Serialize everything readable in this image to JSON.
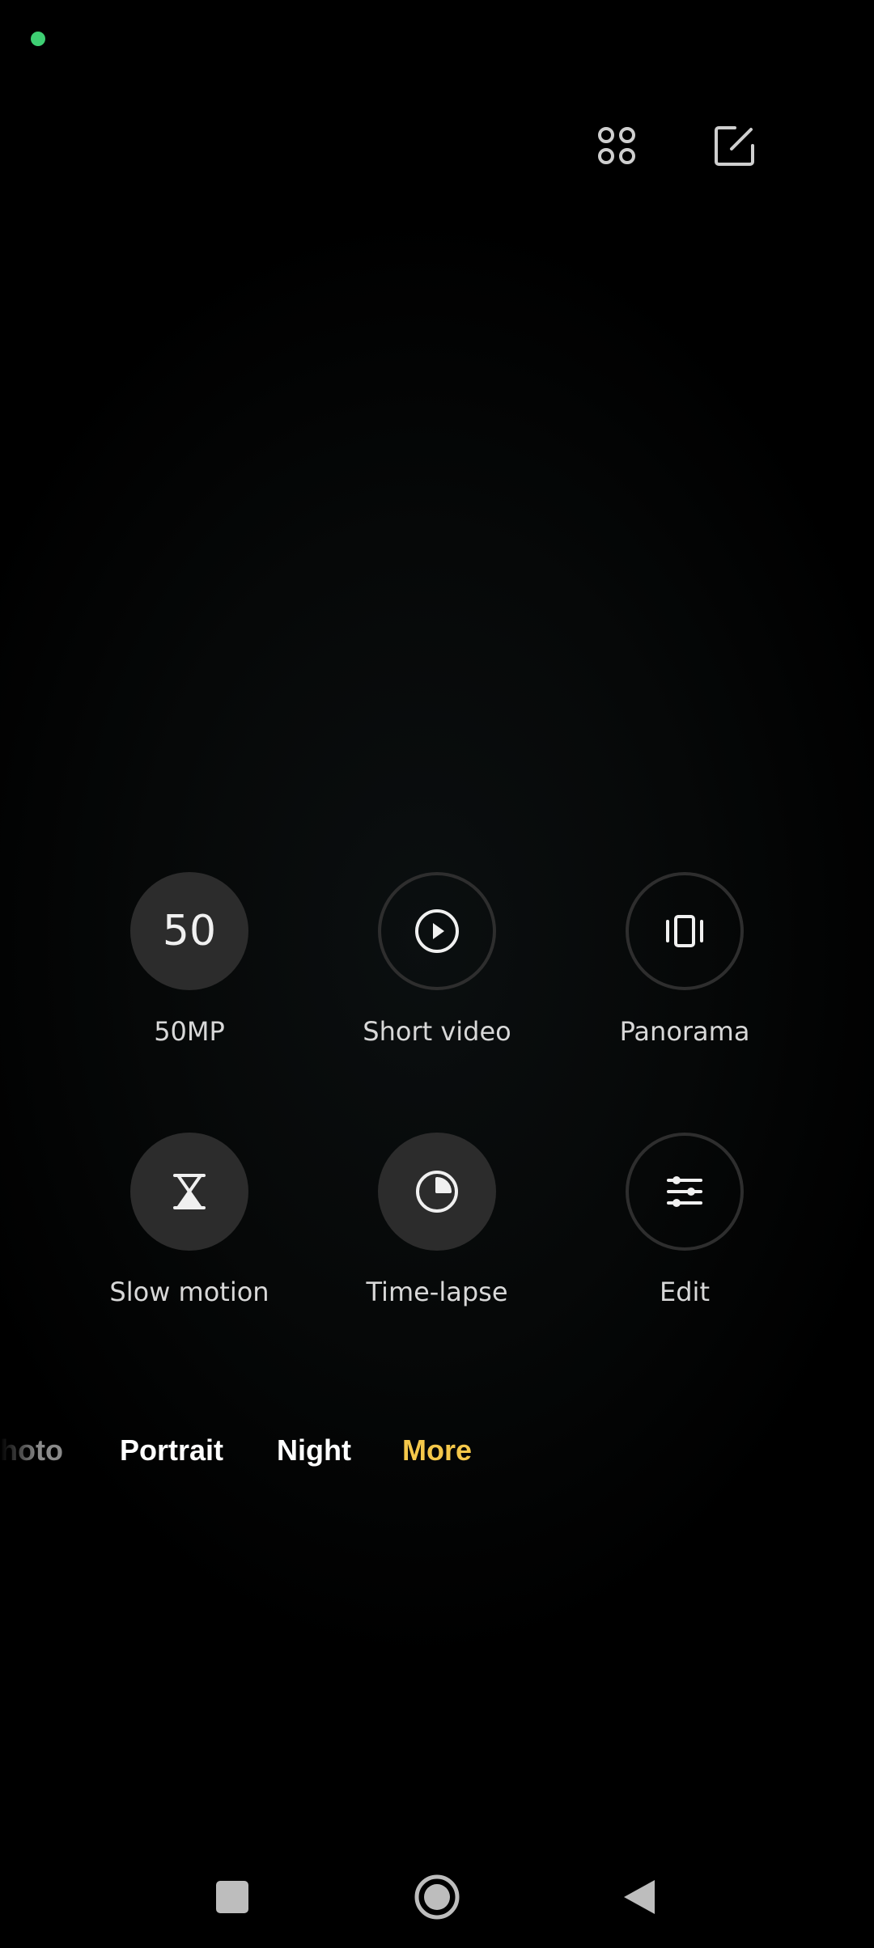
{
  "status": {
    "indicator_color": "#3ecf73"
  },
  "toolbar": {
    "grid_icon": "grid-four-circles-icon",
    "edit_icon": "edit-square-icon"
  },
  "modes": [
    {
      "id": "50mp",
      "label": "50MP",
      "badge": "50",
      "icon": "50mp-text-icon",
      "style": "filled"
    },
    {
      "id": "short-video",
      "label": "Short video",
      "icon": "play-circle-icon",
      "style": "outline"
    },
    {
      "id": "panorama",
      "label": "Panorama",
      "icon": "panorama-icon",
      "style": "outline"
    },
    {
      "id": "slow-motion",
      "label": "Slow motion",
      "icon": "hourglass-icon",
      "style": "filled"
    },
    {
      "id": "time-lapse",
      "label": "Time-lapse",
      "icon": "clock-icon",
      "style": "filled"
    },
    {
      "id": "edit",
      "label": "Edit",
      "icon": "sliders-icon",
      "style": "outline"
    }
  ],
  "mode_bar": {
    "tabs": [
      {
        "label": "Photo",
        "visible_text": "hoto"
      },
      {
        "label": "Portrait"
      },
      {
        "label": "Night"
      },
      {
        "label": "More",
        "active": true
      }
    ],
    "active_color": "#f5c84a"
  },
  "nav": {
    "recents_icon": "square-icon",
    "home_icon": "home-circle-icon",
    "back_icon": "back-triangle-icon"
  }
}
